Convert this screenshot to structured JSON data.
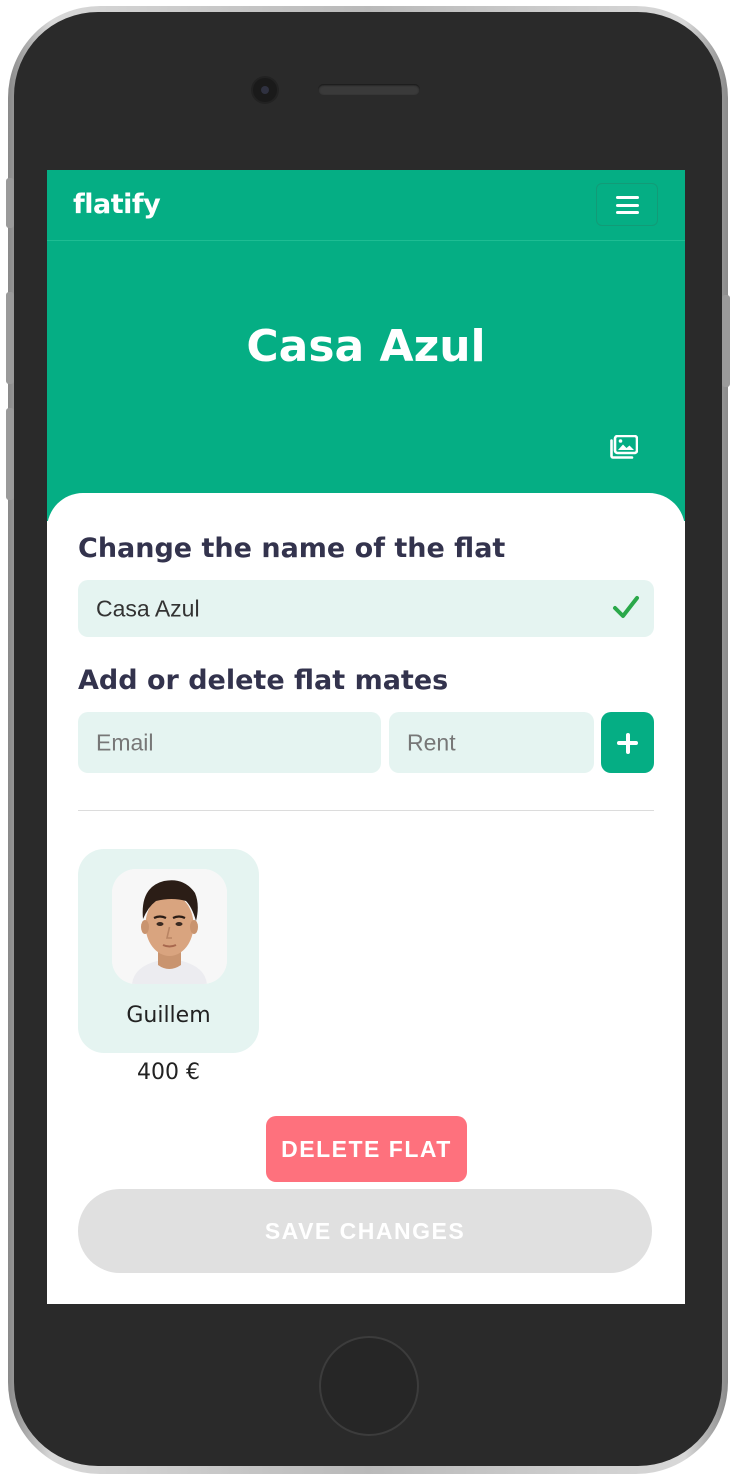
{
  "app": {
    "logo": "flatify"
  },
  "header": {
    "menu_icon": "hamburger-menu-icon"
  },
  "hero": {
    "flat_name": "Casa Azul",
    "change_image_icon": "image-gallery-icon"
  },
  "rename_section": {
    "title": "Change the name of the flat",
    "value": "Casa Azul",
    "valid_icon": "checkmark-icon"
  },
  "mates_section": {
    "title": "Add or delete flat mates",
    "email_placeholder": "Email",
    "rent_placeholder": "Rent",
    "add_icon": "plus-icon"
  },
  "flat_mates": [
    {
      "name": "Guillem",
      "rent": "400 €"
    }
  ],
  "actions": {
    "delete_label": "DELETE FLAT",
    "save_label": "SAVE CHANGES"
  },
  "colors": {
    "brand": "#05ae84",
    "field_bg": "#e5f4f1",
    "delete": "#fe717d",
    "save_disabled": "#e0e0e0",
    "heading": "#33334d"
  }
}
